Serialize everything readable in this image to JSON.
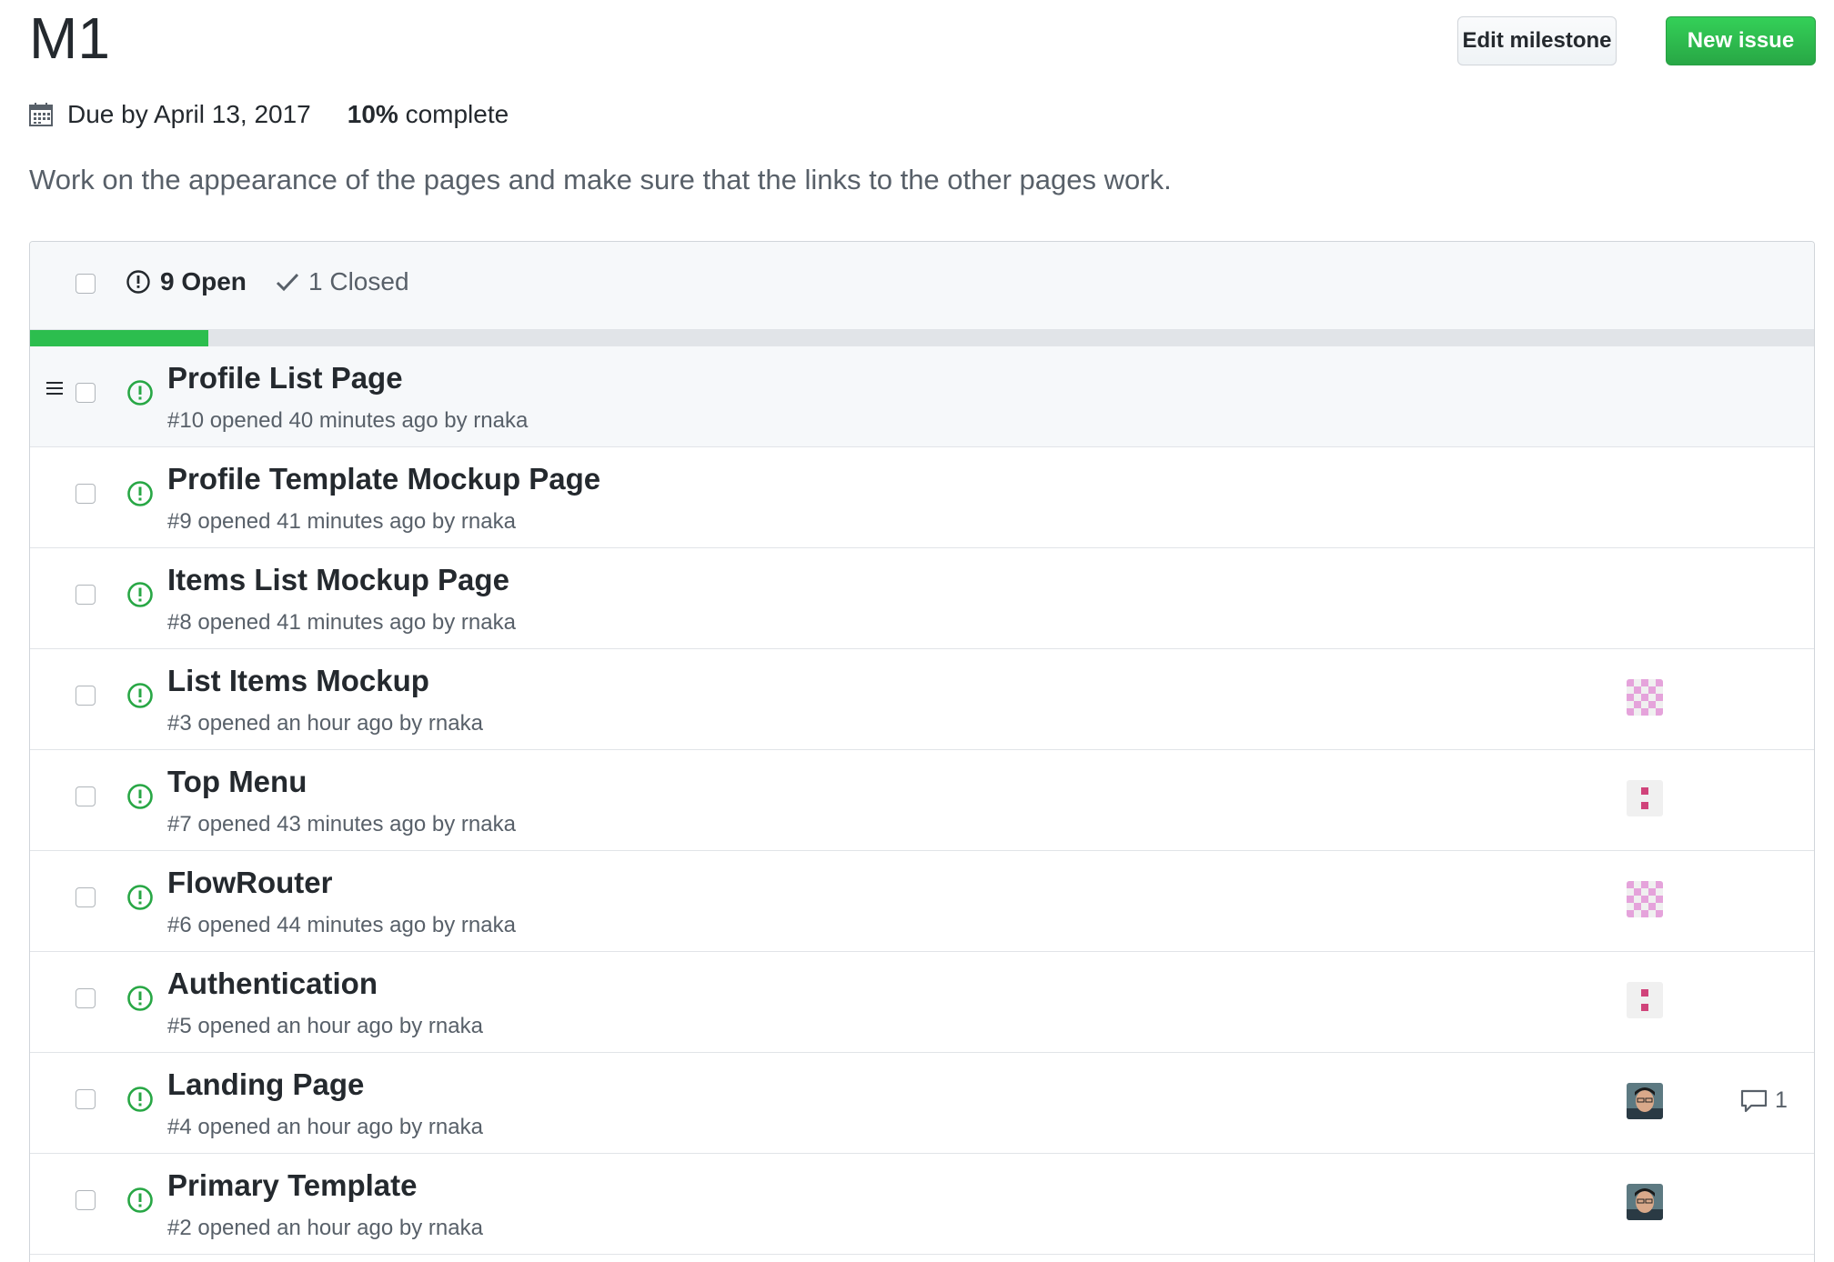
{
  "milestone": {
    "title": "M1",
    "due": "Due by April 13, 2017",
    "percent": "10%",
    "percent_suffix": " complete",
    "progress_fraction": 0.1,
    "description": "Work on the appearance of the pages and make sure that the links to the other pages work."
  },
  "buttons": {
    "edit_label": "Edit milestone",
    "new_label": "New issue"
  },
  "header": {
    "open_label": "9 Open",
    "closed_label": "1 Closed"
  },
  "colors": {
    "open_icon": "#28a745",
    "progress": "#2cbe4e",
    "new_button": "#28a745"
  },
  "issues": [
    {
      "title": "Profile List Page",
      "sub": "#10 opened 40 minutes ago by rnaka",
      "avatar": "none",
      "comments": ""
    },
    {
      "title": "Profile Template Mockup Page",
      "sub": "#9 opened 41 minutes ago by rnaka",
      "avatar": "none",
      "comments": ""
    },
    {
      "title": "Items List Mockup Page",
      "sub": "#8 opened 41 minutes ago by rnaka",
      "avatar": "none",
      "comments": ""
    },
    {
      "title": "List Items Mockup",
      "sub": "#3 opened an hour ago by rnaka",
      "avatar": "identicon-pink",
      "comments": ""
    },
    {
      "title": "Top Menu",
      "sub": "#7 opened 43 minutes ago by rnaka",
      "avatar": "identicon-red",
      "comments": ""
    },
    {
      "title": "FlowRouter",
      "sub": "#6 opened 44 minutes ago by rnaka",
      "avatar": "identicon-pink",
      "comments": ""
    },
    {
      "title": "Authentication",
      "sub": "#5 opened an hour ago by rnaka",
      "avatar": "identicon-red",
      "comments": ""
    },
    {
      "title": "Landing Page",
      "sub": "#4 opened an hour ago by rnaka",
      "avatar": "photo",
      "comments": "1"
    },
    {
      "title": "Primary Template",
      "sub": "#2 opened an hour ago by rnaka",
      "avatar": "photo",
      "comments": ""
    }
  ]
}
